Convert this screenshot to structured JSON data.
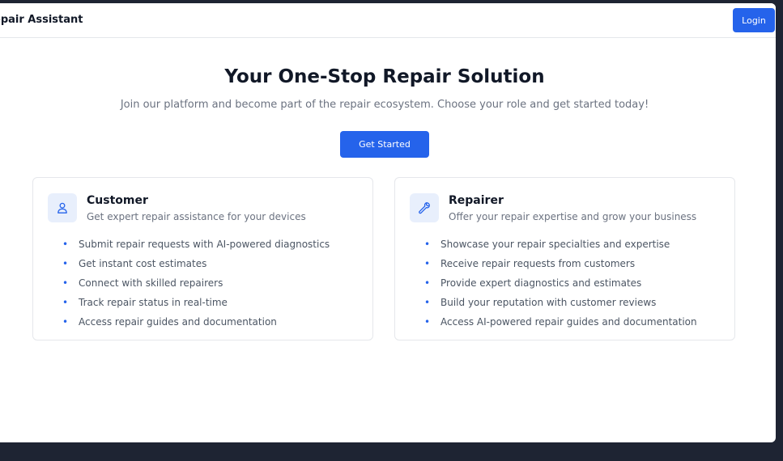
{
  "header": {
    "brand": "epair Assistant",
    "login_label": "Login"
  },
  "hero": {
    "title": "Your One-Stop Repair Solution",
    "subtitle": "Join our platform and become part of the repair ecosystem. Choose your role and get started today!",
    "cta_label": "Get Started"
  },
  "cards": [
    {
      "icon": "user-icon",
      "title": "Customer",
      "subtitle": "Get expert repair assistance for your devices",
      "features": [
        "Submit repair requests with AI-powered diagnostics",
        "Get instant cost estimates",
        "Connect with skilled repairers",
        "Track repair status in real-time",
        "Access repair guides and documentation"
      ]
    },
    {
      "icon": "wrench-icon",
      "title": "Repairer",
      "subtitle": "Offer your repair expertise and grow your business",
      "features": [
        "Showcase your repair specialties and expertise",
        "Receive repair requests from customers",
        "Provide expert diagnostics and estimates",
        "Build your reputation with customer reviews",
        "Access AI-powered repair guides and documentation"
      ]
    }
  ],
  "colors": {
    "accent": "#2563eb",
    "icon_bg": "#e8effc",
    "frame": "#1e2433"
  }
}
